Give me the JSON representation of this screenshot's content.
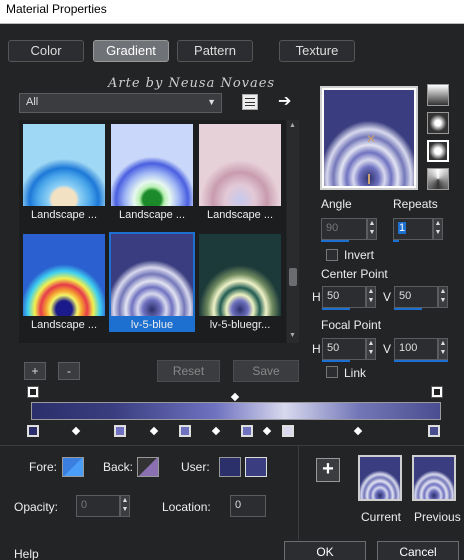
{
  "window": {
    "title": "Material Properties"
  },
  "tabs": [
    {
      "label": "Color",
      "active": false
    },
    {
      "label": "Gradient",
      "active": true
    },
    {
      "label": "Pattern",
      "active": false
    },
    {
      "label": "Texture",
      "active": false
    }
  ],
  "watermark": "Arte by Neusa Novaes",
  "category_select": {
    "value": "All"
  },
  "gallery": [
    {
      "label": "Landscape ...",
      "icon": "gradient-thumb-landscape-blue"
    },
    {
      "label": "Landscape ...",
      "icon": "gradient-thumb-landscape-green"
    },
    {
      "label": "Landscape ...",
      "icon": "gradient-thumb-landscape-pink"
    },
    {
      "label": "Landscape ...",
      "icon": "gradient-thumb-landscape-rainbow"
    },
    {
      "label": "lv-5-blue",
      "icon": "gradient-thumb-lv5-blue",
      "selected": true
    },
    {
      "label": "lv-5-bluegr...",
      "icon": "gradient-thumb-lv5-bluegreen"
    }
  ],
  "buttons": {
    "add": "+",
    "remove": "-",
    "reset": "Reset",
    "save": "Save"
  },
  "angle": {
    "label": "Angle",
    "value": "90"
  },
  "repeats": {
    "label": "Repeats",
    "value": "1"
  },
  "invert": {
    "label": "Invert",
    "checked": false
  },
  "center_point": {
    "label": "Center Point",
    "h_label": "H",
    "h_value": "50",
    "v_label": "V",
    "v_value": "50"
  },
  "focal_point": {
    "label": "Focal Point",
    "h_label": "H",
    "h_value": "50",
    "v_label": "V",
    "v_value": "100"
  },
  "link": {
    "label": "Link",
    "checked": false
  },
  "fore": {
    "label": "Fore:"
  },
  "back": {
    "label": "Back:"
  },
  "user": {
    "label": "User:"
  },
  "opacity": {
    "label": "Opacity:",
    "value": "0"
  },
  "location": {
    "label": "Location:",
    "value": "0"
  },
  "current": {
    "label": "Current"
  },
  "previous": {
    "label": "Previous"
  },
  "footer": {
    "help": "Help",
    "ok": "OK",
    "cancel": "Cancel"
  },
  "colors": {
    "accent": "#1d6fd0",
    "gradient_dark": "#2b2f6a",
    "gradient_mid": "#6f72c0",
    "gradient_light": "#d8d9ee"
  }
}
